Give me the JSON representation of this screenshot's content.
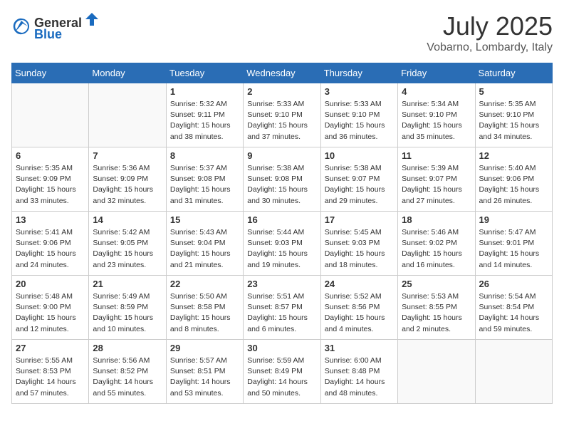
{
  "header": {
    "logo_general": "General",
    "logo_blue": "Blue",
    "month": "July 2025",
    "location": "Vobarno, Lombardy, Italy"
  },
  "days_of_week": [
    "Sunday",
    "Monday",
    "Tuesday",
    "Wednesday",
    "Thursday",
    "Friday",
    "Saturday"
  ],
  "weeks": [
    [
      {
        "day": "",
        "info": ""
      },
      {
        "day": "",
        "info": ""
      },
      {
        "day": "1",
        "info": "Sunrise: 5:32 AM\nSunset: 9:11 PM\nDaylight: 15 hours\nand 38 minutes."
      },
      {
        "day": "2",
        "info": "Sunrise: 5:33 AM\nSunset: 9:10 PM\nDaylight: 15 hours\nand 37 minutes."
      },
      {
        "day": "3",
        "info": "Sunrise: 5:33 AM\nSunset: 9:10 PM\nDaylight: 15 hours\nand 36 minutes."
      },
      {
        "day": "4",
        "info": "Sunrise: 5:34 AM\nSunset: 9:10 PM\nDaylight: 15 hours\nand 35 minutes."
      },
      {
        "day": "5",
        "info": "Sunrise: 5:35 AM\nSunset: 9:10 PM\nDaylight: 15 hours\nand 34 minutes."
      }
    ],
    [
      {
        "day": "6",
        "info": "Sunrise: 5:35 AM\nSunset: 9:09 PM\nDaylight: 15 hours\nand 33 minutes."
      },
      {
        "day": "7",
        "info": "Sunrise: 5:36 AM\nSunset: 9:09 PM\nDaylight: 15 hours\nand 32 minutes."
      },
      {
        "day": "8",
        "info": "Sunrise: 5:37 AM\nSunset: 9:08 PM\nDaylight: 15 hours\nand 31 minutes."
      },
      {
        "day": "9",
        "info": "Sunrise: 5:38 AM\nSunset: 9:08 PM\nDaylight: 15 hours\nand 30 minutes."
      },
      {
        "day": "10",
        "info": "Sunrise: 5:38 AM\nSunset: 9:07 PM\nDaylight: 15 hours\nand 29 minutes."
      },
      {
        "day": "11",
        "info": "Sunrise: 5:39 AM\nSunset: 9:07 PM\nDaylight: 15 hours\nand 27 minutes."
      },
      {
        "day": "12",
        "info": "Sunrise: 5:40 AM\nSunset: 9:06 PM\nDaylight: 15 hours\nand 26 minutes."
      }
    ],
    [
      {
        "day": "13",
        "info": "Sunrise: 5:41 AM\nSunset: 9:06 PM\nDaylight: 15 hours\nand 24 minutes."
      },
      {
        "day": "14",
        "info": "Sunrise: 5:42 AM\nSunset: 9:05 PM\nDaylight: 15 hours\nand 23 minutes."
      },
      {
        "day": "15",
        "info": "Sunrise: 5:43 AM\nSunset: 9:04 PM\nDaylight: 15 hours\nand 21 minutes."
      },
      {
        "day": "16",
        "info": "Sunrise: 5:44 AM\nSunset: 9:03 PM\nDaylight: 15 hours\nand 19 minutes."
      },
      {
        "day": "17",
        "info": "Sunrise: 5:45 AM\nSunset: 9:03 PM\nDaylight: 15 hours\nand 18 minutes."
      },
      {
        "day": "18",
        "info": "Sunrise: 5:46 AM\nSunset: 9:02 PM\nDaylight: 15 hours\nand 16 minutes."
      },
      {
        "day": "19",
        "info": "Sunrise: 5:47 AM\nSunset: 9:01 PM\nDaylight: 15 hours\nand 14 minutes."
      }
    ],
    [
      {
        "day": "20",
        "info": "Sunrise: 5:48 AM\nSunset: 9:00 PM\nDaylight: 15 hours\nand 12 minutes."
      },
      {
        "day": "21",
        "info": "Sunrise: 5:49 AM\nSunset: 8:59 PM\nDaylight: 15 hours\nand 10 minutes."
      },
      {
        "day": "22",
        "info": "Sunrise: 5:50 AM\nSunset: 8:58 PM\nDaylight: 15 hours\nand 8 minutes."
      },
      {
        "day": "23",
        "info": "Sunrise: 5:51 AM\nSunset: 8:57 PM\nDaylight: 15 hours\nand 6 minutes."
      },
      {
        "day": "24",
        "info": "Sunrise: 5:52 AM\nSunset: 8:56 PM\nDaylight: 15 hours\nand 4 minutes."
      },
      {
        "day": "25",
        "info": "Sunrise: 5:53 AM\nSunset: 8:55 PM\nDaylight: 15 hours\nand 2 minutes."
      },
      {
        "day": "26",
        "info": "Sunrise: 5:54 AM\nSunset: 8:54 PM\nDaylight: 14 hours\nand 59 minutes."
      }
    ],
    [
      {
        "day": "27",
        "info": "Sunrise: 5:55 AM\nSunset: 8:53 PM\nDaylight: 14 hours\nand 57 minutes."
      },
      {
        "day": "28",
        "info": "Sunrise: 5:56 AM\nSunset: 8:52 PM\nDaylight: 14 hours\nand 55 minutes."
      },
      {
        "day": "29",
        "info": "Sunrise: 5:57 AM\nSunset: 8:51 PM\nDaylight: 14 hours\nand 53 minutes."
      },
      {
        "day": "30",
        "info": "Sunrise: 5:59 AM\nSunset: 8:49 PM\nDaylight: 14 hours\nand 50 minutes."
      },
      {
        "day": "31",
        "info": "Sunrise: 6:00 AM\nSunset: 8:48 PM\nDaylight: 14 hours\nand 48 minutes."
      },
      {
        "day": "",
        "info": ""
      },
      {
        "day": "",
        "info": ""
      }
    ]
  ]
}
